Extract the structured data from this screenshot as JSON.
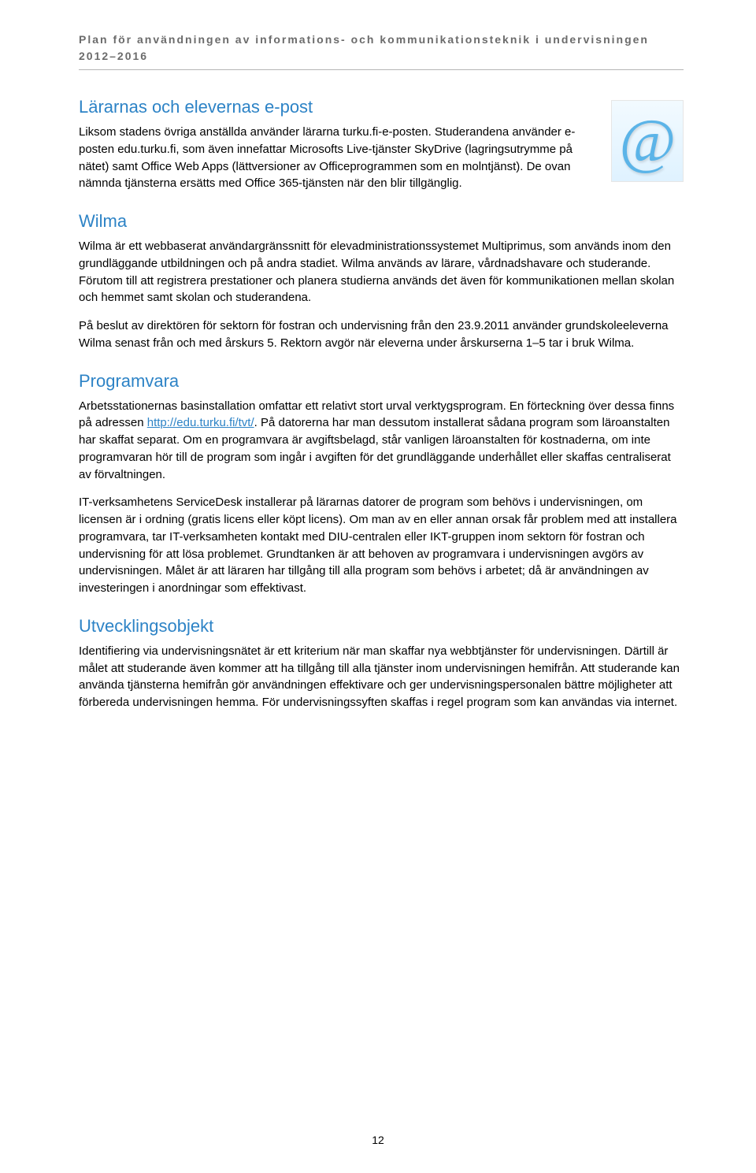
{
  "running_header": {
    "line1": "Plan för användningen av informations- och kommunikationsteknik i undervisningen",
    "line2": "2012–2016"
  },
  "sections": {
    "epost": {
      "title": "Lärarnas och elevernas e-post",
      "p1": "Liksom stadens övriga anställda använder lärarna turku.fi-e-posten. Studerandena använder e-posten edu.turku.fi, som även innefattar Microsofts Live-tjänster SkyDrive (lagringsutrymme på nätet) samt Office Web Apps (lättversioner av Officeprogrammen som en molntjänst). De ovan nämnda tjänsterna ersätts med Office 365-tjänsten när den blir tillgänglig."
    },
    "wilma": {
      "title": "Wilma",
      "p1": "Wilma är ett webbaserat användargränssnitt för elevadministrationssystemet Multiprimus, som används inom den grundläggande utbildningen och på andra stadiet. Wilma används av lärare, vårdnadshavare och studerande. Förutom till att registrera prestationer och planera studierna används det även för kommunikationen mellan skolan och hemmet samt skolan och studerandena.",
      "p2": "På beslut av direktören för sektorn för fostran och undervisning från den 23.9.2011 använder grundskoleeleverna Wilma senast från och med årskurs 5. Rektorn avgör när eleverna under årskurserna 1–5 tar i bruk Wilma."
    },
    "programvara": {
      "title": "Programvara",
      "p1_before_link": "Arbetsstationernas basinstallation omfattar ett relativt stort urval verktygsprogram. En förteckning över dessa finns på adressen ",
      "link_text": "http://edu.turku.fi/tvt/",
      "p1_after_link": ".  På datorerna har man dessutom installerat sådana program som läroanstalten har skaffat separat. Om en programvara är avgiftsbelagd, står vanligen läroanstalten för kostnaderna, om inte programvaran hör till de program som ingår i avgiften för det grundläggande underhållet eller skaffas centraliserat av förvaltningen.",
      "p2": "IT-verksamhetens ServiceDesk installerar på lärarnas datorer de program som behövs i undervisningen, om licensen är i ordning (gratis licens eller köpt licens). Om man av en eller annan orsak får problem med att installera programvara, tar IT-verksamheten kontakt med DIU-centralen eller IKT-gruppen inom sektorn för fostran och undervisning för att lösa problemet. Grundtanken är att behoven av programvara i undervisningen avgörs av undervisningen. Målet är att läraren har tillgång till alla program som behövs i arbetet; då är användningen av investeringen i anordningar som effektivast."
    },
    "utveckling": {
      "title": "Utvecklingsobjekt",
      "p1": "Identifiering via undervisningsnätet är ett kriterium när man skaffar nya webbtjänster för undervisningen. Därtill är målet att studerande även kommer att ha tillgång till alla tjänster inom undervisningen hemifrån. Att studerande kan använda tjänsterna hemifrån gör användningen effektivare och ger undervisningspersonalen bättre möjligheter att förbereda undervisningen hemma. För undervisningssyften skaffas i regel program som kan användas via internet."
    }
  },
  "page_number": "12",
  "icon_glyph": "@"
}
